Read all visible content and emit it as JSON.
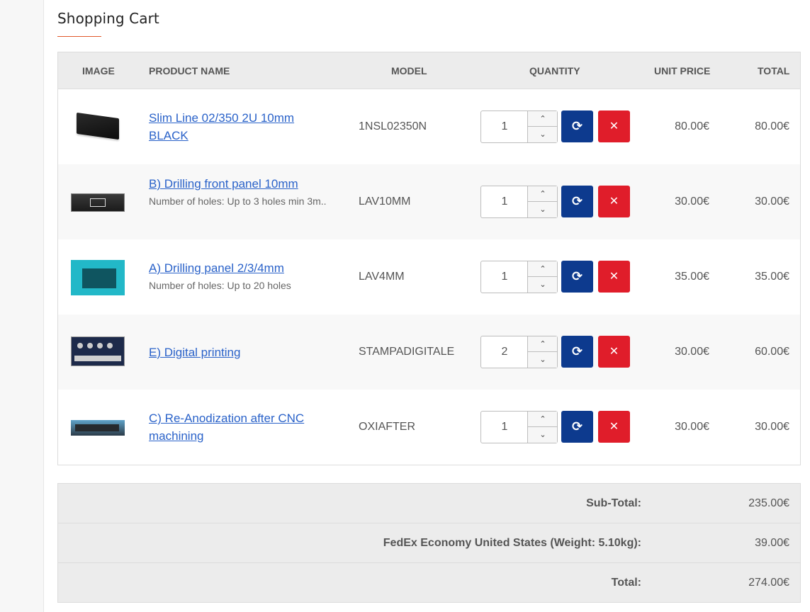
{
  "page": {
    "title": "Shopping Cart"
  },
  "table": {
    "headers": {
      "image": "IMAGE",
      "product_name": "PRODUCT NAME",
      "model": "MODEL",
      "quantity": "QUANTITY",
      "unit_price": "UNIT PRICE",
      "total": "TOTAL"
    },
    "rows": [
      {
        "name": "Slim Line 02/350 2U 10mm BLACK",
        "desc": "",
        "model": "1NSL02350N",
        "qty": "1",
        "unit_price": "80.00€",
        "total": "80.00€",
        "image_icon": "black-enclosure-image"
      },
      {
        "name": "B) Drilling front panel 10mm",
        "desc": "Number of holes: Up to 3 holes min 3m..",
        "model": "LAV10MM",
        "qty": "1",
        "unit_price": "30.00€",
        "total": "30.00€",
        "image_icon": "drilled-black-panel-image"
      },
      {
        "name": "A) Drilling panel 2/3/4mm",
        "desc": "Number of holes: Up to 20 holes",
        "model": "LAV4MM",
        "qty": "1",
        "unit_price": "35.00€",
        "total": "35.00€",
        "image_icon": "blue-panel-image"
      },
      {
        "name": "E) Digital printing",
        "desc": "",
        "model": "STAMPADIGITALE",
        "qty": "2",
        "unit_price": "30.00€",
        "total": "60.00€",
        "image_icon": "printed-panel-image"
      },
      {
        "name": "C) Re-Anodization after CNC machining",
        "desc": "",
        "model": "OXIAFTER",
        "qty": "1",
        "unit_price": "30.00€",
        "total": "30.00€",
        "image_icon": "anodized-panel-image"
      }
    ],
    "controls": {
      "update_icon": "refresh-icon",
      "remove_icon": "close-icon",
      "up_icon": "chevron-up-icon",
      "down_icon": "chevron-down-icon"
    }
  },
  "totals": [
    {
      "label": "Sub-Total:",
      "value": "235.00€"
    },
    {
      "label": "FedEx Economy United States (Weight: 5.10kg):",
      "value": "39.00€"
    },
    {
      "label": "Total:",
      "value": "274.00€"
    }
  ],
  "colors": {
    "link": "#2a62c9",
    "update_button": "#0d3a8e",
    "remove_button": "#e01d2a",
    "title_accent": "#e0592a",
    "header_bg": "#ececec"
  }
}
